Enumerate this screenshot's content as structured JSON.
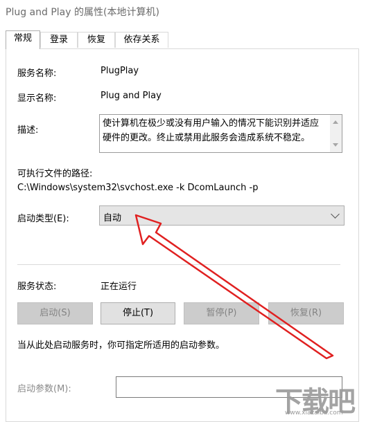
{
  "window": {
    "title": "Plug and Play 的属性(本地计算机)"
  },
  "tabs": [
    {
      "label": "常规",
      "active": true
    },
    {
      "label": "登录",
      "active": false
    },
    {
      "label": "恢复",
      "active": false
    },
    {
      "label": "依存关系",
      "active": false
    }
  ],
  "general": {
    "service_name_label": "服务名称:",
    "service_name_value": "PlugPlay",
    "display_name_label": "显示名称:",
    "display_name_value": "Plug and Play",
    "description_label": "描述:",
    "description_value": "使计算机在极少或没有用户输入的情况下能识别并适应硬件的更改。终止或禁用此服务会造成系统不稳定。",
    "exe_path_label": "可执行文件的路径:",
    "exe_path_value": "C:\\Windows\\system32\\svchost.exe -k DcomLaunch -p",
    "startup_type_label": "启动类型(E):",
    "startup_type_value": "自动",
    "status_label": "服务状态:",
    "status_value": "正在运行",
    "buttons": {
      "start": "启动(S)",
      "stop": "停止(T)",
      "pause": "暂停(P)",
      "resume": "恢复(R)"
    },
    "hint": "当从此处启动服务时，你可指定所适用的启动参数。",
    "start_params_label": "启动参数(M):",
    "start_params_value": ""
  },
  "watermark": {
    "text": "下载吧",
    "url": "www.xiazaiba.com"
  },
  "colors": {
    "annotation_arrow": "#e02020"
  }
}
